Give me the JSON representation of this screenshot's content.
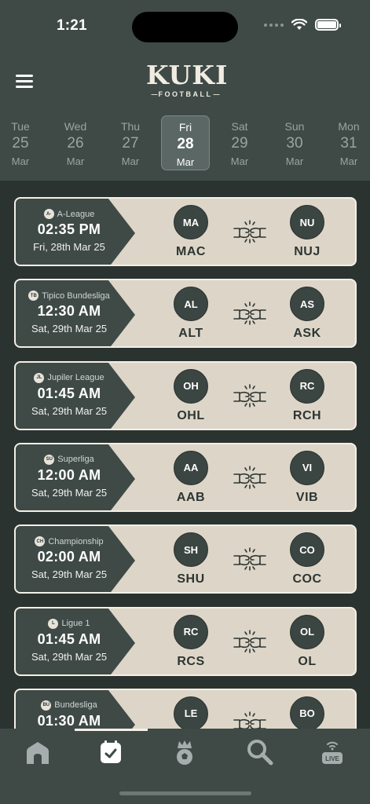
{
  "status_bar": {
    "time": "1:21"
  },
  "header": {
    "logo_main": "KUKI",
    "logo_sub": "FOOTBALL"
  },
  "dates": [
    {
      "dow": "Tue",
      "day": "25",
      "month": "Mar",
      "active": false
    },
    {
      "dow": "Wed",
      "day": "26",
      "month": "Mar",
      "active": false
    },
    {
      "dow": "Thu",
      "day": "27",
      "month": "Mar",
      "active": false
    },
    {
      "dow": "Fri",
      "day": "28",
      "month": "Mar",
      "active": true
    },
    {
      "dow": "Sat",
      "day": "29",
      "month": "Mar",
      "active": false
    },
    {
      "dow": "Sun",
      "day": "30",
      "month": "Mar",
      "active": false
    },
    {
      "dow": "Mon",
      "day": "31",
      "month": "Mar",
      "active": false
    }
  ],
  "matches": [
    {
      "league_badge": "A-",
      "league": "A-League",
      "time": "02:35 PM",
      "date": "Fri, 28th Mar 25",
      "home": {
        "abbr": "MA",
        "code": "MAC"
      },
      "away": {
        "abbr": "NU",
        "code": "NUJ"
      }
    },
    {
      "league_badge": "TB",
      "league": "Tipico Bundesliga",
      "time": "12:30 AM",
      "date": "Sat, 29th Mar 25",
      "home": {
        "abbr": "AL",
        "code": "ALT"
      },
      "away": {
        "abbr": "AS",
        "code": "ASK"
      }
    },
    {
      "league_badge": "JL",
      "league": "Jupiler League",
      "time": "01:45 AM",
      "date": "Sat, 29th Mar 25",
      "home": {
        "abbr": "OH",
        "code": "OHL"
      },
      "away": {
        "abbr": "RC",
        "code": "RCH"
      }
    },
    {
      "league_badge": "SU",
      "league": "Superliga",
      "time": "12:00 AM",
      "date": "Sat, 29th Mar 25",
      "home": {
        "abbr": "AA",
        "code": "AAB"
      },
      "away": {
        "abbr": "VI",
        "code": "VIB"
      }
    },
    {
      "league_badge": "CH",
      "league": "Championship",
      "time": "02:00 AM",
      "date": "Sat, 29th Mar 25",
      "home": {
        "abbr": "SH",
        "code": "SHU"
      },
      "away": {
        "abbr": "CO",
        "code": "COC"
      }
    },
    {
      "league_badge": "L",
      "league": "Ligue 1",
      "time": "01:45 AM",
      "date": "Sat, 29th Mar 25",
      "home": {
        "abbr": "RC",
        "code": "RCS"
      },
      "away": {
        "abbr": "OL",
        "code": "OL"
      }
    },
    {
      "league_badge": "BU",
      "league": "Bundesliga",
      "time": "01:30 AM",
      "date": "",
      "home": {
        "abbr": "LE",
        "code": ""
      },
      "away": {
        "abbr": "BO",
        "code": ""
      }
    }
  ],
  "nav": {
    "items": [
      {
        "icon": "home-icon",
        "active": false
      },
      {
        "icon": "calendar-check-icon",
        "active": true
      },
      {
        "icon": "crown-ball-icon",
        "active": false
      },
      {
        "icon": "search-icon",
        "active": false
      },
      {
        "icon": "live-icon",
        "active": false,
        "label": "LIVE"
      }
    ]
  },
  "colors": {
    "background": "#2b3331",
    "header": "#3f4a47",
    "card": "#ddd6c8",
    "card_dark": "#3f4a47",
    "accent_text": "#2d3533"
  }
}
